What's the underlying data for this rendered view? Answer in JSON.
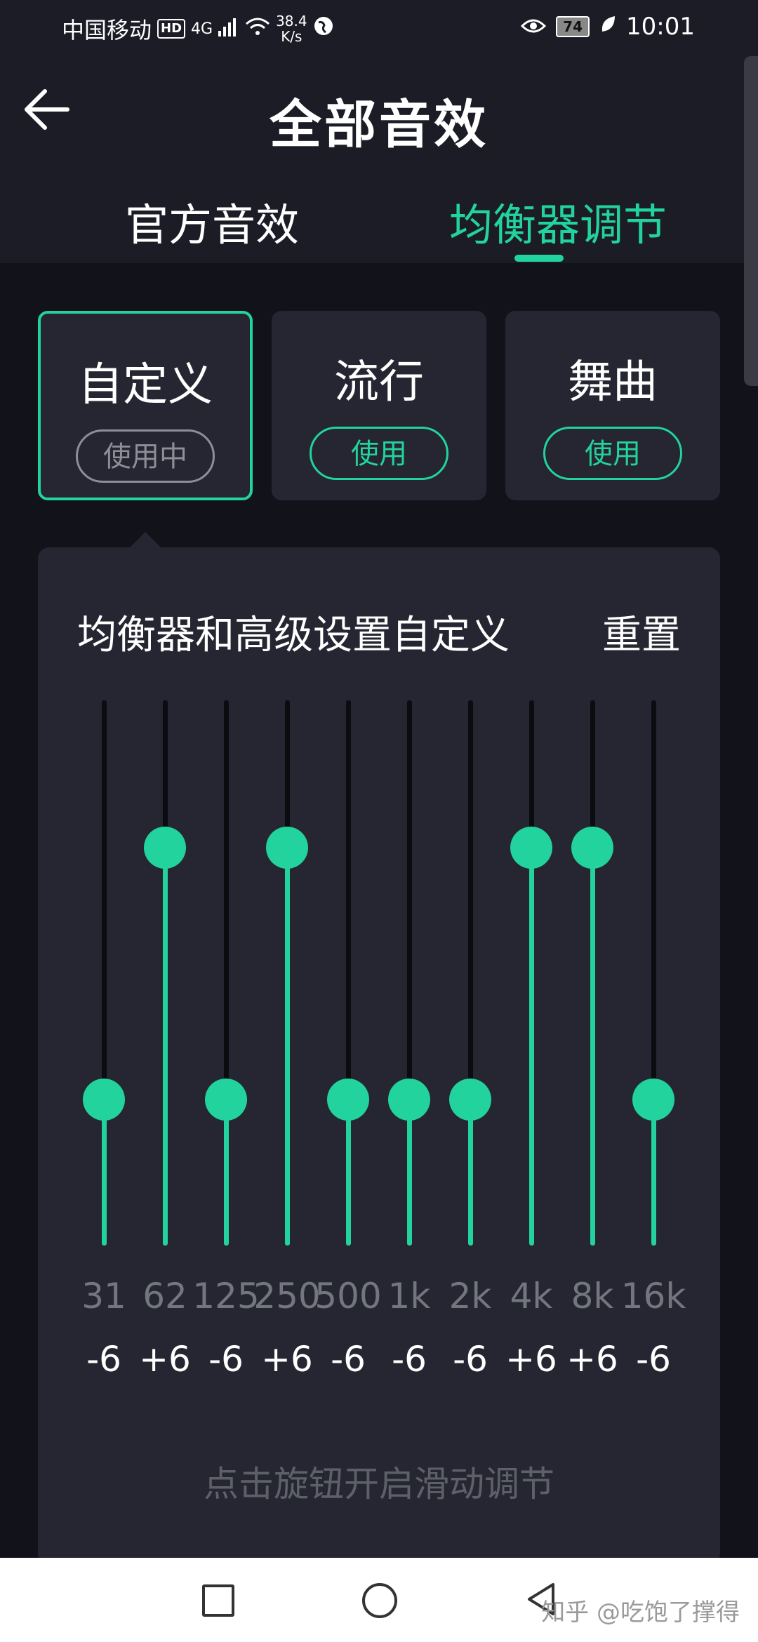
{
  "status_bar": {
    "carrier": "中国移动",
    "hd": "HD",
    "network": "4G",
    "speed_value": "38.4",
    "speed_unit": "K/s",
    "battery": "74",
    "time": "10:01"
  },
  "header": {
    "title": "全部音效",
    "tabs": [
      {
        "label": "官方音效",
        "active": false
      },
      {
        "label": "均衡器调节",
        "active": true
      }
    ]
  },
  "presets": [
    {
      "name": "自定义",
      "button": "使用中",
      "active": true
    },
    {
      "name": "流行",
      "button": "使用",
      "active": false
    },
    {
      "name": "舞曲",
      "button": "使用",
      "active": false
    }
  ],
  "equalizer": {
    "title": "均衡器和高级设置自定义",
    "reset_label": "重置",
    "bands": [
      {
        "freq": "31",
        "gain": "-6",
        "value": -6
      },
      {
        "freq": "62",
        "gain": "+6",
        "value": 6
      },
      {
        "freq": "125",
        "gain": "-6",
        "value": -6
      },
      {
        "freq": "250",
        "gain": "+6",
        "value": 6
      },
      {
        "freq": "500",
        "gain": "-6",
        "value": -6
      },
      {
        "freq": "1k",
        "gain": "-6",
        "value": -6
      },
      {
        "freq": "2k",
        "gain": "-6",
        "value": -6
      },
      {
        "freq": "4k",
        "gain": "+6",
        "value": 6
      },
      {
        "freq": "8k",
        "gain": "+6",
        "value": 6
      },
      {
        "freq": "16k",
        "gain": "-6",
        "value": -6
      }
    ],
    "hint": "点击旋钮开启滑动调节"
  },
  "colors": {
    "accent": "#22d39d",
    "background": "#11121a",
    "card": "#252631"
  },
  "watermark": "知乎 @吃饱了撑得"
}
